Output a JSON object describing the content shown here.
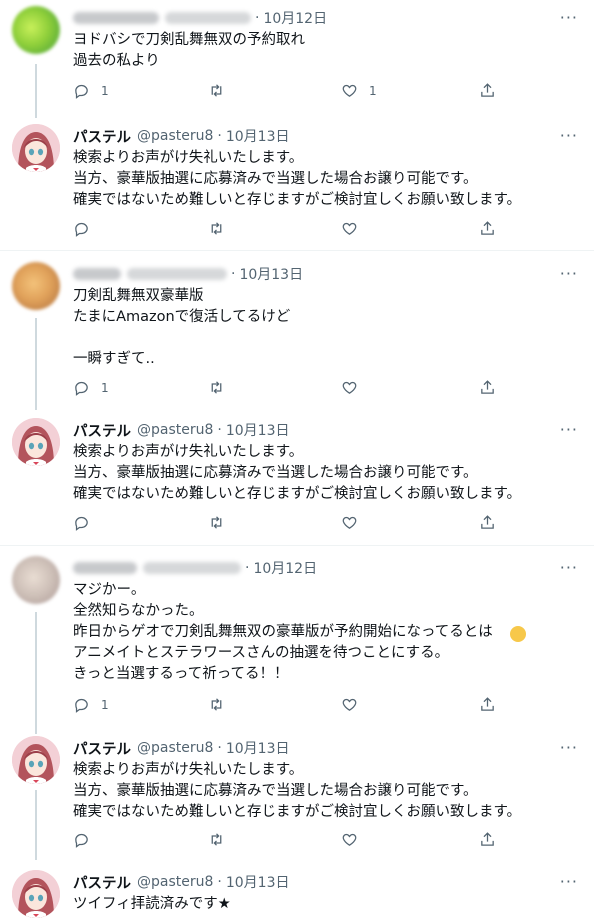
{
  "tweets": [
    {
      "name": "",
      "handle": "",
      "date": "10月12日",
      "text": "ヨドバシで刀剣乱舞無双の予約取れ\n過去の私より",
      "reply_count": "1",
      "retweet_count": "",
      "like_count": "1"
    },
    {
      "name": "パステル",
      "handle": "@pasteru8",
      "date": "10月13日",
      "text": "検索よりお声がけ失礼いたします。\n当方、豪華版抽選に応募済みで当選した場合お譲り可能です。\n確実ではないため難しいと存じますがご検討宜しくお願い致します。",
      "reply_count": "",
      "retweet_count": "",
      "like_count": ""
    },
    {
      "name": "",
      "handle": "",
      "date": "10月13日",
      "text": "刀剣乱舞無双豪華版\nたまにAmazonで復活してるけど\n\n一瞬すぎて..",
      "reply_count": "1",
      "retweet_count": "",
      "like_count": ""
    },
    {
      "name": "パステル",
      "handle": "@pasteru8",
      "date": "10月13日",
      "text": "検索よりお声がけ失礼いたします。\n当方、豪華版抽選に応募済みで当選した場合お譲り可能です。\n確実ではないため難しいと存じますがご検討宜しくお願い致します。",
      "reply_count": "",
      "retweet_count": "",
      "like_count": ""
    },
    {
      "name": "",
      "handle": "",
      "date": "10月12日",
      "text": "マジかー。\n全然知らなかった。\n昨日からゲオで刀剣乱舞無双の豪華版が予約開始になってるとは\nアニメイトとステラワースさんの抽選を待つことにする。\nきっと当選するって祈ってる！！",
      "reply_count": "1",
      "retweet_count": "",
      "like_count": ""
    },
    {
      "name": "パステル",
      "handle": "@pasteru8",
      "date": "10月13日",
      "text": "検索よりお声がけ失礼いたします。\n当方、豪華版抽選に応募済みで当選した場合お譲り可能です。\n確実ではないため難しいと存じますがご検討宜しくお願い致します。",
      "reply_count": "",
      "retweet_count": "",
      "like_count": ""
    },
    {
      "name": "パステル",
      "handle": "@pasteru8",
      "date": "10月13日",
      "text": "ツイフィ拝読済みです★",
      "reply_count": "",
      "retweet_count": "",
      "like_count": ""
    }
  ],
  "icons": {
    "reply": "reply-icon",
    "retweet": "retweet-icon",
    "like": "like-icon",
    "share": "share-icon",
    "more": "more-icon"
  },
  "colors": {
    "text": "#0f1419",
    "secondary": "#536471",
    "thread": "#cfd9de",
    "divider": "#eff3f4"
  }
}
